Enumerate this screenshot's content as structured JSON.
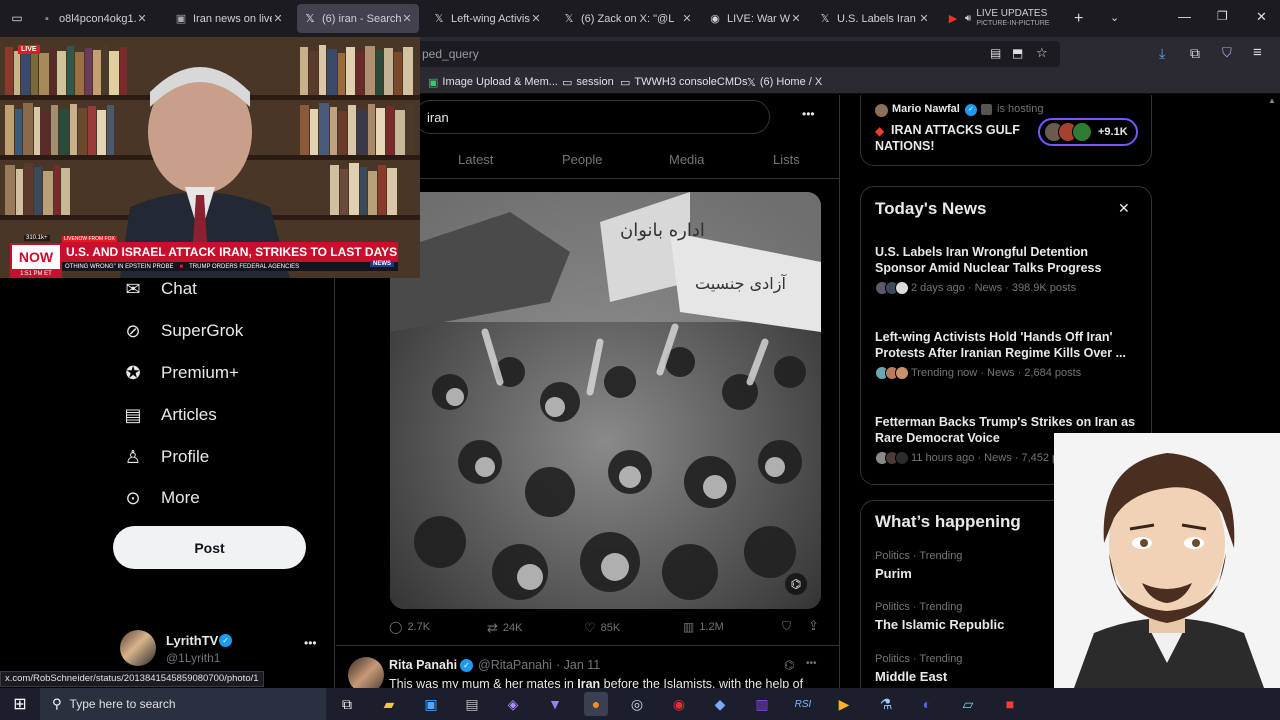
{
  "browser": {
    "tabs": [
      {
        "icon": "image-icon",
        "label": "o8l4pcon4okg1.jpeg (J",
        "active": false
      },
      {
        "icon": "news-icon",
        "label": "Iran news on live n",
        "active": false
      },
      {
        "icon": "x-logo-icon",
        "label": "(6) iran - Search / X",
        "active": true
      },
      {
        "icon": "x-logo-icon",
        "label": "Left-wing Activists",
        "active": false
      },
      {
        "icon": "x-logo-icon",
        "label": "(6) Zack on X: \"@L",
        "active": false
      },
      {
        "icon": "live-icon",
        "label": "LIVE: War With",
        "active": false
      },
      {
        "icon": "x-logo-icon",
        "label": "U.S. Labels Iran W",
        "active": false
      },
      {
        "icon": "youtube-icon",
        "label": "LIVE UPDATES",
        "sublabel": "PICTURE-IN-PICTURE",
        "active": false
      }
    ],
    "url_fragment": "ped_query",
    "bookmarks": [
      {
        "icon": "image-icon",
        "label": "Image Upload & Mem..."
      },
      {
        "icon": "folder-icon",
        "label": "session"
      },
      {
        "icon": "folder-icon",
        "label": "TWWH3 consoleCMDs"
      },
      {
        "icon": "x-logo-icon",
        "label": "(6) Home / X"
      }
    ],
    "status_url": "x.com/RobSchneider/status/2013841545859080700/photo/1"
  },
  "pip": {
    "live_badge": "LIVE",
    "now_badge": "NOW",
    "time": "1:51 PM ET",
    "channel": "LIVENOW FROM FOX",
    "viewers": "310.1k+",
    "headline": "U.S. AND ISRAEL ATTACK IRAN, STRIKES TO LAST DAYS",
    "ticker_left": "OTHING WRONG\" IN EPSTEIN PROBE",
    "ticker_right": "TRUMP ORDERS FEDERAL AGENCIES",
    "news_tag": "NEWS"
  },
  "sidebar": {
    "items": [
      {
        "icon": "chat-icon",
        "label": "Chat"
      },
      {
        "icon": "grok-icon",
        "label": "SuperGrok"
      },
      {
        "icon": "premium-icon",
        "label": "Premium+"
      },
      {
        "icon": "articles-icon",
        "label": "Articles"
      },
      {
        "icon": "profile-icon",
        "label": "Profile"
      },
      {
        "icon": "more-icon",
        "label": "More"
      }
    ],
    "post_label": "Post",
    "account": {
      "name": "LyrithTV",
      "handle": "@1Lyrith1"
    }
  },
  "search": {
    "query": "iran",
    "tabs": [
      "Latest",
      "People",
      "Media",
      "Lists"
    ]
  },
  "tweet": {
    "stats": {
      "replies": "2.7K",
      "reposts": "24K",
      "likes": "85K",
      "views": "1.2M"
    },
    "banner_text_1": "اداره بانوان",
    "banner_text_2": "آزادی جنسیت"
  },
  "next_tweet": {
    "name": "Rita Panahi",
    "handle": "@RitaPanahi",
    "date": "· Jan 11",
    "text_before": "This was my mum & her mates in ",
    "text_bold": "Iran",
    "text_after": " before the Islamists, with the help of"
  },
  "space": {
    "host": "Mario Nawfal",
    "hosting": "is hosting",
    "title": "IRAN ATTACKS GULF NATIONS!",
    "listeners": "+9.1K"
  },
  "todays_news": {
    "title": "Today's News",
    "items": [
      {
        "headline": "U.S. Labels Iran Wrongful Detention Sponsor Amid Nuclear Talks Progress",
        "meta": "2 days ago · News · 398.9K posts"
      },
      {
        "headline": "Left-wing Activists Hold 'Hands Off Iran' Protests After Iranian Regime Kills Over ...",
        "meta": "Trending now · News · 2,684 posts"
      },
      {
        "headline": "Fetterman Backs Trump's Strikes on Iran as Rare Democrat Voice",
        "meta": "11 hours ago · News · 7,452 p"
      }
    ]
  },
  "whats_happening": {
    "title": "What’s happening",
    "items": [
      {
        "context": "Politics · Trending",
        "topic": "Purim"
      },
      {
        "context": "Politics · Trending",
        "topic": "The Islamic Republic"
      },
      {
        "context": "Politics · Trending",
        "topic": "Middle East"
      }
    ]
  },
  "taskbar": {
    "search_placeholder": "Type here to search",
    "apps": [
      "task-view-icon",
      "file-explorer-icon",
      "store-icon",
      "files-icon",
      "vpn-icon",
      "vs-icon",
      "firefox-icon",
      "steam-icon",
      "malwarebytes-icon",
      "dev-icon",
      "twitch-icon",
      "rsi-icon",
      "media-icon",
      "tool-icon",
      "discord-icon",
      "notepad-icon",
      "recorder-icon"
    ]
  },
  "colors": {
    "x_blue": "#1d9bf0",
    "fox_red": "#c8102e",
    "space_purple": "#7856ff",
    "tab_active": "#42414d"
  }
}
